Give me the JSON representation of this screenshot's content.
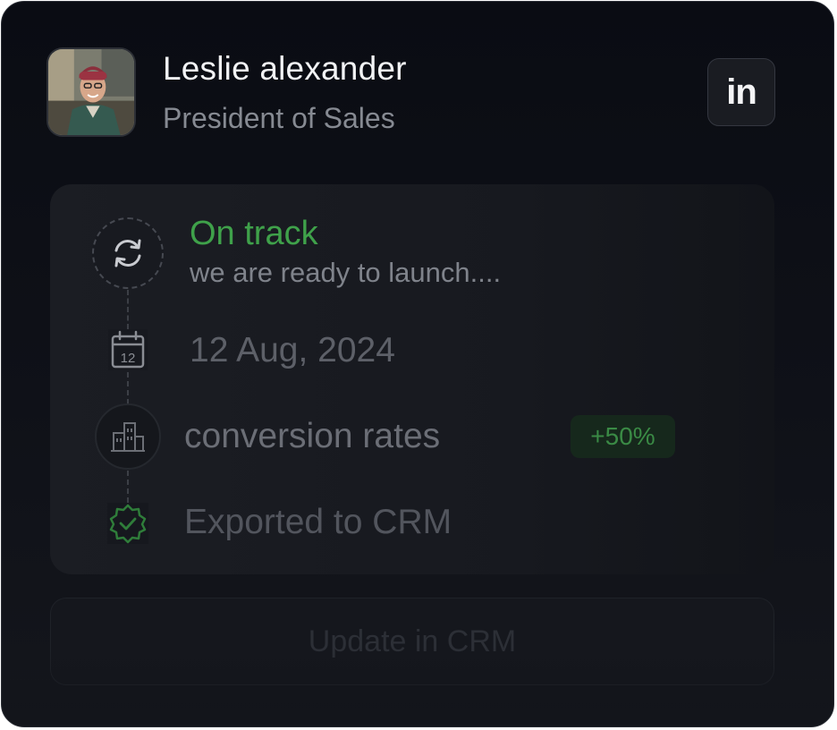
{
  "profile": {
    "name": "Leslie alexander",
    "role": "President of Sales",
    "avatar_icon": "user-photo",
    "linkedin_label": "in"
  },
  "status": {
    "title": "On track",
    "description": "we are ready to launch....",
    "color": "#3fa14a",
    "icon": "refresh-icon"
  },
  "date": {
    "text": "12 Aug, 2024",
    "icon": "calendar-icon",
    "icon_day": "12"
  },
  "metric": {
    "label": "conversion rates",
    "badge": "+50%",
    "icon": "building-icon"
  },
  "export": {
    "text": "Exported to CRM",
    "icon": "verified-badge-icon"
  },
  "action": {
    "button_label": "Update in CRM"
  }
}
